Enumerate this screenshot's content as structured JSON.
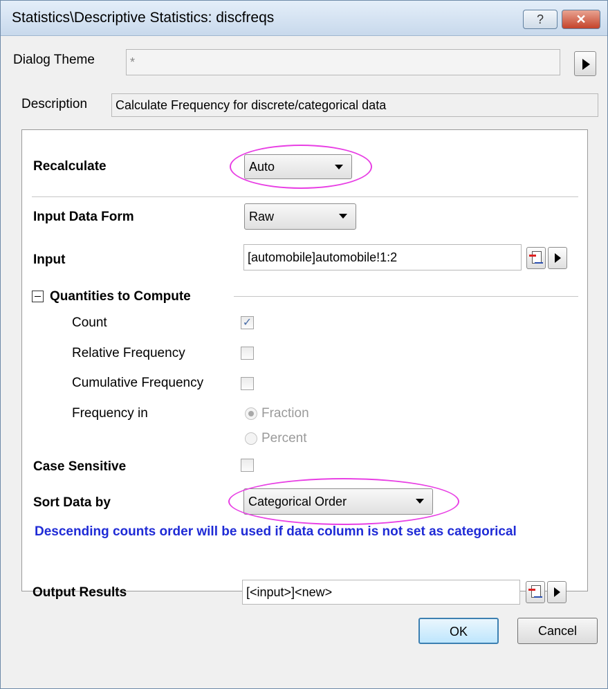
{
  "window": {
    "title": "Statistics\\Descriptive Statistics: discfreqs",
    "help_label": "?",
    "close_label": "✕"
  },
  "dialog_theme": {
    "label": "Dialog Theme",
    "value": "*"
  },
  "description": {
    "label": "Description",
    "value": "Calculate Frequency for discrete/categorical data"
  },
  "recalculate": {
    "label": "Recalculate",
    "value": "Auto"
  },
  "input_data_form": {
    "label": "Input Data Form",
    "value": "Raw"
  },
  "input": {
    "label": "Input",
    "value": "[automobile]automobile!1:2"
  },
  "quantities": {
    "heading": "Quantities to Compute",
    "count": {
      "label": "Count",
      "checked": true
    },
    "relative_frequency": {
      "label": "Relative Frequency",
      "checked": false
    },
    "cumulative_frequency": {
      "label": "Cumulative Frequency",
      "checked": false
    },
    "frequency_in": {
      "label": "Frequency in",
      "options": [
        "Fraction",
        "Percent"
      ],
      "selected": "Fraction",
      "enabled": false
    }
  },
  "case_sensitive": {
    "label": "Case Sensitive",
    "checked": false
  },
  "sort_data_by": {
    "label": "Sort Data by",
    "value": "Categorical Order"
  },
  "note": "Descending counts order will be used if data column is not set as categorical",
  "output_results": {
    "label": "Output Results",
    "value": "[<input>]<new>"
  },
  "buttons": {
    "ok": "OK",
    "cancel": "Cancel"
  },
  "colors": {
    "highlight": "#e83fe4",
    "note_text": "#1f2bd6"
  }
}
